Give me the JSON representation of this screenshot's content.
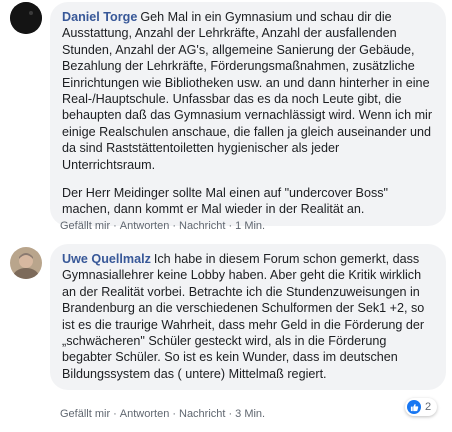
{
  "comments": [
    {
      "author": "Daniel Torge",
      "paragraphs": [
        "Geh Mal in ein Gymnasium und schau dir die Ausstattung, Anzahl der Lehrkräfte, Anzahl der ausfallenden Stunden, Anzahl der AG's, allgemeine Sanierung der Gebäude, Bezahlung der Lehrkräfte, Förderungsmaßnahmen, zusätzliche Einrichtungen wie Bibliotheken usw. an und dann hinterher in eine Real-/Hauptschule. Unfassbar das es da noch Leute gibt, die behaupten daß das Gymnasium vernachlässigt wird. Wenn ich mir einige Realschulen anschaue, die fallen ja gleich auseinander und da sind Raststättentoiletten hygienischer als jeder Unterrichtsraum.",
        "Der Herr Meidinger sollte Mal einen auf \"undercover Boss\" machen, dann kommt er Mal wieder in der Realität an."
      ],
      "actions": {
        "like": "Gefällt mir",
        "reply": "Antworten",
        "message": "Nachricht",
        "time": "1 Min."
      }
    },
    {
      "author": "Uwe Quellmalz",
      "paragraphs": [
        "Ich habe in diesem Forum schon gemerkt, dass Gymnasiallehrer keine Lobby haben. Aber geht die Kritik wirklich an der Realität vorbei. Betrachte ich die Stundenzuweisungen in Brandenburg an die verschiedenen Schulformen der Sek1 +2, so ist es die traurige Wahrheit, dass mehr Geld in die Förderung der „schwächeren\" Schüler gesteckt wird, als in die Förderung begabter Schüler. So ist es kein Wunder, dass im deutschen Bildungssystem das ( untere) Mittelmaß regiert."
      ],
      "actions": {
        "like": "Gefällt mir",
        "reply": "Antworten",
        "message": "Nachricht",
        "time": "3 Min."
      },
      "reaction_count": "2"
    }
  ],
  "separator": "·",
  "colors": {
    "author": "#385898",
    "bubble": "#f2f3f5",
    "like_blue": "#1877f2"
  }
}
